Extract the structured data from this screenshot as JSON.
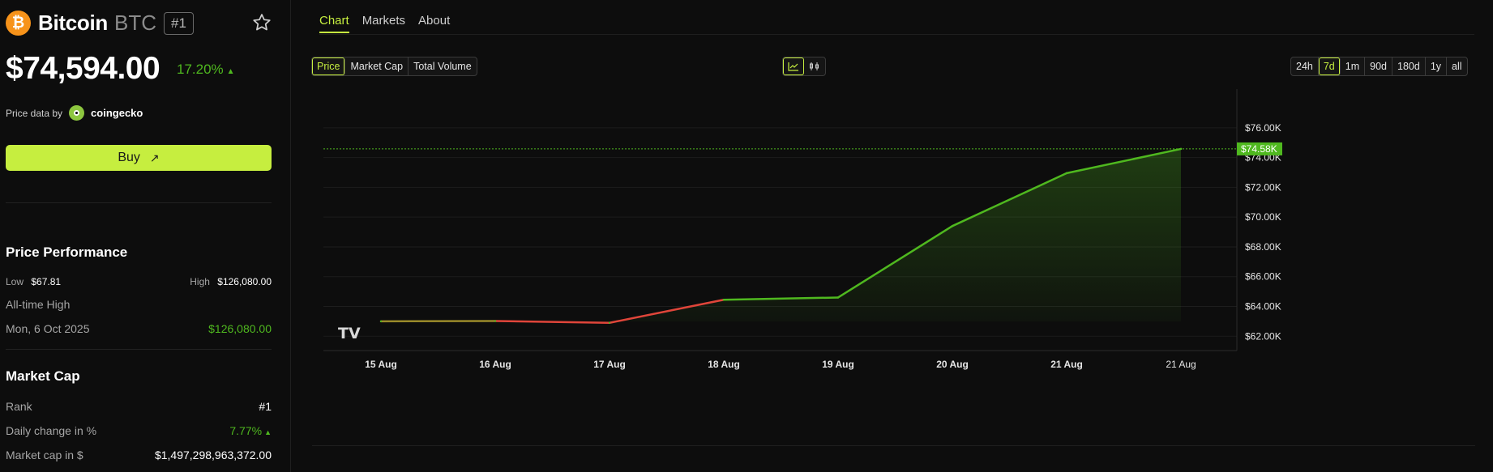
{
  "coin": {
    "logo_glyph": "₿",
    "name": "Bitcoin",
    "symbol": "BTC",
    "rank_badge": "#1",
    "price": "$74,594.00",
    "change": "17.20%",
    "change_arrow": "▲",
    "source_prefix": "Price data by",
    "source_name": "coingecko"
  },
  "buy_label": "Buy",
  "buy_arrow": "↗",
  "performance": {
    "title": "Price Performance",
    "low_label": "Low",
    "low_value": "$67.81",
    "high_label": "High",
    "high_value": "$126,080.00",
    "ath_label": "All-time High",
    "ath_date": "Mon, 6 Oct 2025",
    "ath_value": "$126,080.00"
  },
  "market_cap": {
    "title": "Market Cap",
    "rank_label": "Rank",
    "rank_value": "#1",
    "daily_label": "Daily change in %",
    "daily_value": "7.77%",
    "daily_arrow": "▲",
    "cap_label": "Market cap in $",
    "cap_value": "$1,497,298,963,372.00"
  },
  "tabs": [
    {
      "label": "Chart"
    },
    {
      "label": "Markets"
    },
    {
      "label": "About"
    }
  ],
  "metrics": [
    {
      "label": "Price"
    },
    {
      "label": "Market Cap"
    },
    {
      "label": "Total Volume"
    }
  ],
  "ranges": [
    {
      "label": "24h"
    },
    {
      "label": "7d"
    },
    {
      "label": "1m"
    },
    {
      "label": "90d"
    },
    {
      "label": "180d"
    },
    {
      "label": "1y"
    },
    {
      "label": "all"
    }
  ],
  "colors": {
    "accent": "#c6ee3f",
    "up": "#4fb81f",
    "down": "#e0453a",
    "bitcoin": "#f7931a"
  },
  "chart_data": {
    "type": "area",
    "selected_metric": "Price",
    "selected_range": "7d",
    "x": [
      "15 Aug",
      "16 Aug",
      "17 Aug",
      "18 Aug",
      "19 Aug",
      "20 Aug",
      "21 Aug",
      "21 Aug"
    ],
    "values": [
      63000,
      63020,
      62900,
      64450,
      64600,
      69400,
      72950,
      74580
    ],
    "ylim": [
      61200,
      78600
    ],
    "y_ticks": [
      {
        "value": 62000,
        "label": "$62.00K"
      },
      {
        "value": 64000,
        "label": "$64.00K"
      },
      {
        "value": 66000,
        "label": "$66.00K"
      },
      {
        "value": 68000,
        "label": "$68.00K"
      },
      {
        "value": 70000,
        "label": "$70.00K"
      },
      {
        "value": 72000,
        "label": "$72.00K"
      },
      {
        "value": 74000,
        "label": "$74.00K"
      },
      {
        "value": 76000,
        "label": "$76.00K"
      }
    ],
    "current_value": 74580,
    "current_label": "$74.58K",
    "grid": true,
    "watermark": "TV"
  }
}
